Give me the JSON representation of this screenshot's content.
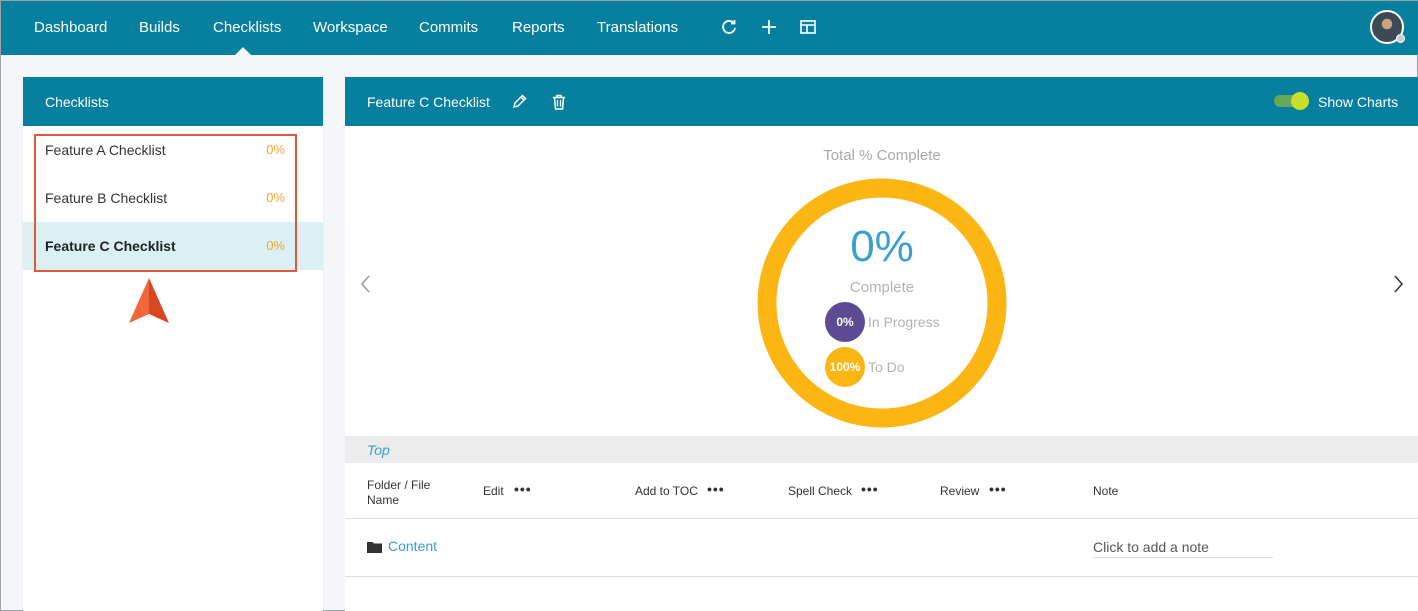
{
  "nav": {
    "items": [
      "Dashboard",
      "Builds",
      "Checklists",
      "Workspace",
      "Commits",
      "Reports",
      "Translations"
    ],
    "active": "Checklists",
    "tools": [
      "refresh-icon",
      "plus-icon",
      "layout-icon"
    ]
  },
  "sidebar": {
    "title": "Checklists",
    "items": [
      {
        "label": "Feature A Checklist",
        "pct": "0%"
      },
      {
        "label": "Feature B Checklist",
        "pct": "0%"
      },
      {
        "label": "Feature C Checklist",
        "pct": "0%"
      }
    ],
    "selected_index": 2
  },
  "main": {
    "title": "Feature C Checklist",
    "show_charts_label": "Show Charts",
    "show_charts_on": true,
    "chart": {
      "title": "Total % Complete",
      "percent": "0%",
      "complete_label": "Complete",
      "in_progress": {
        "value": "0%",
        "label": "In Progress"
      },
      "to_do": {
        "value": "100%",
        "label": "To Do"
      }
    },
    "section_label": "Top",
    "columns": {
      "name_line1": "Folder / File",
      "name_line2": "Name",
      "edit": "Edit",
      "add_to_toc": "Add to TOC",
      "spell_check": "Spell Check",
      "review": "Review",
      "note": "Note",
      "dots": "•••"
    },
    "rows": [
      {
        "name": "Content",
        "note_placeholder": "Click to add a note"
      }
    ]
  },
  "colors": {
    "header": "#06809e",
    "accent_orange": "#f3a52a",
    "ring": "#fbb614",
    "in_progress": "#5c4a93",
    "link_blue": "#3aa0d0",
    "highlight": "#e2583a"
  }
}
